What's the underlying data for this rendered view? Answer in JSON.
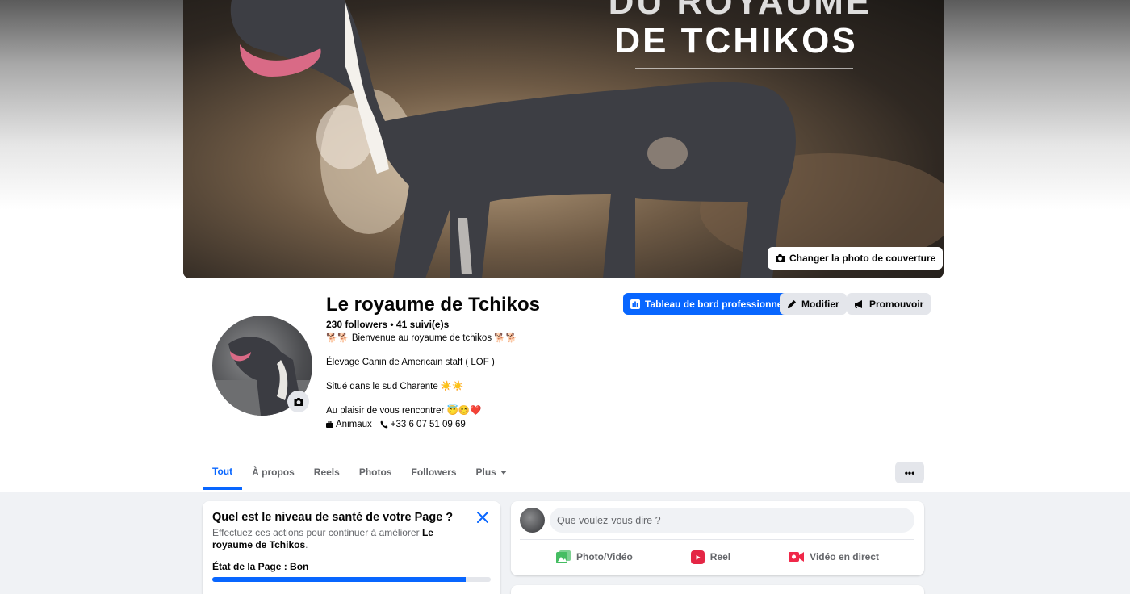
{
  "cover": {
    "title_line1": "DU ROYAUME",
    "title_line2": "DE TCHIKOS",
    "change_cover_label": "Changer la photo de couverture"
  },
  "profile": {
    "name": "Le royaume de Tchikos",
    "stats": "230 followers • 41 suivi(e)s",
    "bio": [
      "🐕🐕 Bienvenue au royaume de tchikos 🐕🐕",
      "Élevage Canin de Americain staff ( LOF )",
      "Situé dans le sud Charente ☀️☀️",
      "Au plaisir de vous rencontrer 😇😊❤️"
    ],
    "category": "Animaux",
    "phone": "+33 6 07 51 09 69"
  },
  "actions": {
    "dashboard": "Tableau de bord professionnel",
    "edit": "Modifier",
    "promote": "Promouvoir"
  },
  "tabs": [
    {
      "label": "Tout",
      "active": true
    },
    {
      "label": "À propos",
      "active": false
    },
    {
      "label": "Reels",
      "active": false
    },
    {
      "label": "Photos",
      "active": false
    },
    {
      "label": "Followers",
      "active": false
    },
    {
      "label": "Plus",
      "active": false
    }
  ],
  "more_label": "•••",
  "health": {
    "title": "Quel est le niveau de santé de votre Page ?",
    "subtitle_prefix": "Effectuez ces actions pour continuer à améliorer",
    "subtitle_page": "Le royaume de Tchikos",
    "subtitle_suffix": ".",
    "state": "État de la Page : Bon",
    "progress": 0.91
  },
  "composer": {
    "placeholder": "Que voulez-vous dire ?",
    "photo_video": "Photo/Vidéo",
    "reel": "Reel",
    "live": "Vidéo en direct"
  },
  "colors": {
    "accent": "#0866ff",
    "photo_green": "#45bd62",
    "reel_pink": "#e42645",
    "live_red": "#f02849"
  }
}
